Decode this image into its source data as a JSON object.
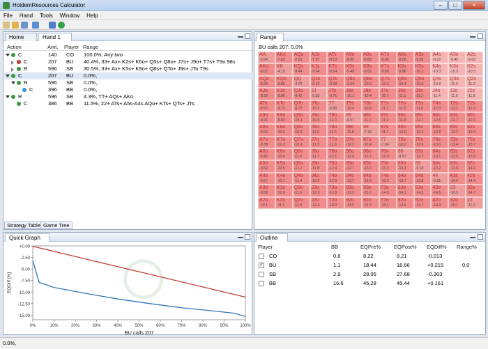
{
  "window": {
    "title": "HoldemResources Calculator",
    "min": "–",
    "max": "□",
    "close": "×"
  },
  "menu": [
    "File",
    "Hand",
    "Tools",
    "Window",
    "Help"
  ],
  "left_panel": {
    "tabs": [
      {
        "label": "Home"
      },
      {
        "label": "Hand 1"
      }
    ],
    "columns": [
      "Action",
      "Amt.",
      "Player",
      "Range"
    ],
    "rows": [
      {
        "expander": "down",
        "dot": "#3a9a3a",
        "action": "C",
        "amt": "140",
        "player": "CO",
        "range": "100.0%, Any two",
        "indent": 0,
        "selected": false
      },
      {
        "expander": "right",
        "dot": "#c0392b",
        "action": "C",
        "amt": "207",
        "player": "BU",
        "range": "40.4%, 33+ Ax+ K2s+ K6o+ Q5s+ Q8o+ J7s+ J9o+ T7s+ T9o 98s",
        "indent": 1,
        "selected": false
      },
      {
        "expander": "right",
        "dot": "#3a9a3a",
        "action": "R",
        "amt": "596",
        "player": "SB",
        "range": "30.5%, 33+ Ax+ K5s+ K9o+ Q8s+ QTo+ J9s+ JTo T9s",
        "indent": 1,
        "selected": false
      },
      {
        "expander": "down",
        "dot": "#3a9a3a",
        "action": "C",
        "amt": "207",
        "player": "BU",
        "range": "0.0%,",
        "indent": 0,
        "selected": true
      },
      {
        "expander": "down",
        "dot": "#3a9a3a",
        "action": "R",
        "amt": "596",
        "player": "SB",
        "range": "0.0%,",
        "indent": 1,
        "selected": false
      },
      {
        "expander": "none",
        "dot": "#3b8fd6",
        "action": "C",
        "amt": "396",
        "player": "BB",
        "range": "0.0%,",
        "indent": 2,
        "selected": false
      },
      {
        "expander": "down",
        "dot": "#3a9a3a",
        "action": "R",
        "amt": "596",
        "player": "SB",
        "range": "4.3%, TT+ AQs+ AKo",
        "indent": 0,
        "selected": false
      },
      {
        "expander": "none",
        "dot": "#3a9a3a",
        "action": "C",
        "amt": "386",
        "player": "BB",
        "range": "11.5%, 22+ ATs+ A5s-A4s AQo+ KTs+ QTs+ JTs",
        "indent": 1,
        "selected": false
      }
    ],
    "bottom_tabs": [
      "Strategy Table",
      "Game Tree"
    ]
  },
  "range_panel": {
    "tab": "Range",
    "subtitle": "BU calls 207: 0.0%",
    "grid": [
      [
        "AA",
        "-3.54",
        "AKs",
        "-7.63",
        "AQs",
        "-7.81",
        "AJs",
        "-7.97",
        "ATs",
        "-8.13",
        "A9s",
        "-8.65",
        "A8s",
        "-8.88",
        "A7s",
        "-8.99",
        "A6s",
        "-9.06",
        "A5s",
        "-9.03",
        "A4s",
        "-9.22",
        "A3s",
        "-9.42",
        "A2s",
        "-9.62"
      ],
      [
        "AKo",
        "-8.02",
        "KK",
        "-4.19",
        "KQs",
        "-9.44",
        "KJs",
        "-9.64",
        "KTs",
        "-9.14",
        "K9s",
        "-9.49",
        "K8s",
        "-9.62",
        "K7s",
        "-9.86",
        "K6s",
        "-9.96",
        "K5s",
        "-10.1",
        "K4s",
        "-10.3",
        "K3s",
        "-10.3",
        "K2s",
        "-10.5"
      ],
      [
        "AQo",
        "-8.29",
        "KQo",
        "-9.80",
        "QQ",
        "-4.76",
        "QJs",
        "-9.12",
        "QTs",
        "-9.28",
        "Q9s",
        "-9.64",
        "Q8s",
        "-10.0",
        "Q7s",
        "-10.2",
        "Q6s",
        "-10.4",
        "Q5s",
        "-10.6",
        "Q4s",
        "-10.8",
        "Q3s",
        "-11.0",
        "Q2s",
        "-11.2"
      ],
      [
        "AJo",
        "-8.39",
        "KJo",
        "-9.96",
        "QJo",
        "-9.42",
        "JJ",
        "-5.33",
        "JTs",
        "-9.71",
        "J9s",
        "-10.1",
        "J8s",
        "-10.4",
        "J7s",
        "-10.7",
        "J6s",
        "-11.1",
        "J5s",
        "-11.2",
        "J4s",
        "-11.4",
        "J3s",
        "-11.6",
        "J2s",
        "-11.8"
      ],
      [
        "ATo",
        "-8.53",
        "KTo",
        "-9.73",
        "QTo",
        "-9.77",
        "JTo",
        "-10.2",
        "TT",
        "-5.89",
        "T9s",
        "-10.4",
        "T8s",
        "-10.8",
        "T7s",
        "-11.1",
        "T6s",
        "-11.5",
        "T5s",
        "-11.8",
        "T4s",
        "-12.0",
        "T3s",
        "-12.2",
        "T2s",
        "-12.4"
      ],
      [
        "A9o",
        "-8.96",
        "K9o",
        "-9.83",
        "Q9o",
        "-10.1",
        "J9o",
        "-10.6",
        "T9o",
        "-11.0",
        "99",
        "-6.57",
        "98s",
        "-11.1",
        "97s",
        "-11.4",
        "96s",
        "-11.8",
        "95s",
        "-12.2",
        "94s",
        "-12.6",
        "93s",
        "-12.7",
        "92s",
        "-12.9"
      ],
      [
        "A8o",
        "-9.23",
        "K8o",
        "-10.0",
        "Q8o",
        "-10.6",
        "J8o",
        "-11.0",
        "T8o",
        "-11.5",
        "98o",
        "-11.8",
        "88",
        "-7.33",
        "87s",
        "-11.7",
        "86s",
        "-12.0",
        "85s",
        "-12.4",
        "84s",
        "-12.8",
        "83s",
        "-13.2",
        "82s",
        "-13.4"
      ],
      [
        "A7o",
        "-9.38",
        "K7o",
        "-10.3",
        "Q7o",
        "-10.9",
        "J7o",
        "-11.3",
        "T7o",
        "-11.8",
        "97o",
        "-12.2",
        "87o",
        "-12.4",
        "77",
        "-7.96",
        "76s",
        "-12.2",
        "75s",
        "-12.6",
        "74s",
        "-13.0",
        "73s",
        "-13.4",
        "72s",
        "-13.7"
      ],
      [
        "A6o",
        "-9.45",
        "K6o",
        "-10.4",
        "Q6o",
        "-11.0",
        "J6o",
        "-11.7",
        "T6o",
        "-12.1",
        "96o",
        "-12.4",
        "86o",
        "-12.7",
        "76o",
        "-12.9",
        "66",
        "-8.57",
        "65s",
        "-12.7",
        "64s",
        "-13.1",
        "63s",
        "-13.5",
        "62s",
        "-13.9"
      ],
      [
        "A5o",
        "-9.52",
        "K5o",
        "-10.5",
        "Q5o",
        "-11.2",
        "J5o",
        "-11.8",
        "T5o",
        "-12.4",
        "95o",
        "-12.7",
        "85o",
        "-13.0",
        "75o",
        "-13.2",
        "65o",
        "-13.3",
        "55",
        "-9.18",
        "54s",
        "-13.2",
        "53s",
        "-13.6",
        "52s",
        "-14.0"
      ],
      [
        "A4o",
        "-9.67",
        "K4o",
        "-10.7",
        "Q4o",
        "-11.4",
        "J4o",
        "-12.0",
        "T4o",
        "-12.6",
        "94o",
        "-13.1",
        "84o",
        "-13.3",
        "74o",
        "-13.5",
        "64o",
        "-13.7",
        "54o",
        "-13.8",
        "44",
        "-9.81",
        "43s",
        "-14.0",
        "42s",
        "-14.4"
      ],
      [
        "A3o",
        "-9.88",
        "K3o",
        "-10.9",
        "Q3o",
        "-11.6",
        "J3o",
        "-12.2",
        "T3o",
        "-12.8",
        "93o",
        "-13.2",
        "83o",
        "-13.7",
        "73o",
        "-14.0",
        "63o",
        "-14.1",
        "53o",
        "-14.3",
        "43o",
        "-14.5",
        "33",
        "-10.5",
        "32s",
        "-14.7"
      ],
      [
        "A2o",
        "-10.1",
        "K2o",
        "-11.1",
        "Q2o",
        "-11.8",
        "J2o",
        "-12.4",
        "T2o",
        "-13.0",
        "92o",
        "-13.5",
        "82o",
        "-13.7",
        "72o",
        "-14.1",
        "62o",
        "-14.6",
        "52o",
        "-14.7",
        "42o",
        "-14.9",
        "32o",
        "-15.1",
        "22",
        "-11.2"
      ]
    ]
  },
  "quick_graph": {
    "tab": "Quick Graph",
    "ylabel": "EQDiff [%]",
    "xlabel": "BU calls 207",
    "chart_data": {
      "type": "line",
      "ylim": [
        -16,
        0
      ],
      "xlim": [
        0,
        100
      ],
      "yticks": [
        "+0.00",
        "-2.50",
        "-5.00",
        "-7.50",
        "-10.00",
        "-12.50",
        "-15.00"
      ],
      "xticks": [
        "0%",
        "10%",
        "20%",
        "30%",
        "40%",
        "50%",
        "60%",
        "70%",
        "80%",
        "90%",
        "100%"
      ],
      "series": [
        {
          "color": "#c0392b",
          "x": [
            0,
            100
          ],
          "y": [
            -0.1,
            -11.1
          ]
        },
        {
          "color": "#2e75b6",
          "x": [
            0,
            3,
            10,
            25,
            40,
            55,
            70,
            85,
            95,
            100
          ],
          "y": [
            -3.2,
            -7.9,
            -9.0,
            -10.3,
            -11.5,
            -12.5,
            -13.4,
            -14.1,
            -14.6,
            -15.3
          ]
        }
      ]
    }
  },
  "outline": {
    "tab": "Outline",
    "columns": [
      "Player",
      "BB",
      "EQPre%",
      "EQPost%",
      "EQDiff%",
      "Range%"
    ],
    "rows": [
      {
        "checked": false,
        "player": "CO",
        "bb": "0.8",
        "eqpre": "8.22",
        "eqpost": "8.21",
        "eqdiff": "-0.013",
        "range": ""
      },
      {
        "checked": true,
        "player": "BU",
        "bb": "1.1",
        "eqpre": "18.44",
        "eqpost": "18.66",
        "eqdiff": "+0.215",
        "range": "0.0"
      },
      {
        "checked": false,
        "player": "SB",
        "bb": "2.9",
        "eqpre": "28.05",
        "eqpost": "27.68",
        "eqdiff": "-0.363",
        "range": ""
      },
      {
        "checked": false,
        "player": "BB",
        "bb": "16.6",
        "eqpre": "45.28",
        "eqpost": "45.44",
        "eqdiff": "+0.161",
        "range": ""
      }
    ]
  },
  "status": "0.0%,",
  "colors": {
    "cell_red": "#f28b8b",
    "cell_light": "#f6b3b3",
    "cell_pink": "#ef9c9c"
  }
}
